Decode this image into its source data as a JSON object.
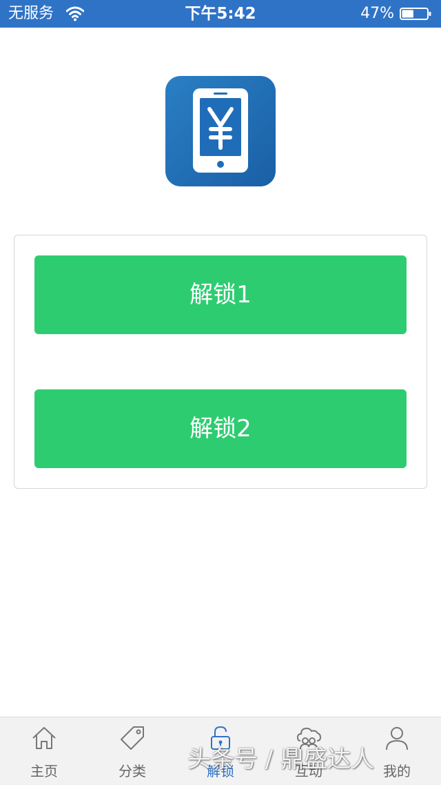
{
  "status_bar": {
    "carrier": "无服务",
    "time": "下午5:42",
    "battery_percent": "47%",
    "battery_level": 0.47
  },
  "main": {
    "app_icon": "yen-phone-icon",
    "buttons": [
      {
        "label": "解锁1"
      },
      {
        "label": "解锁2"
      }
    ]
  },
  "tab_bar": {
    "active_index": 2,
    "active_color": "#2f73c6",
    "tabs": [
      {
        "label": "主页",
        "icon": "home-icon"
      },
      {
        "label": "分类",
        "icon": "tag-icon"
      },
      {
        "label": "解锁",
        "icon": "unlock-icon"
      },
      {
        "label": "互动",
        "icon": "community-icon"
      },
      {
        "label": "我的",
        "icon": "user-icon"
      }
    ]
  },
  "watermark": "头条号 / 鼎盛达人",
  "colors": {
    "status_bar": "#2f73c6",
    "button": "#2ecc71"
  }
}
